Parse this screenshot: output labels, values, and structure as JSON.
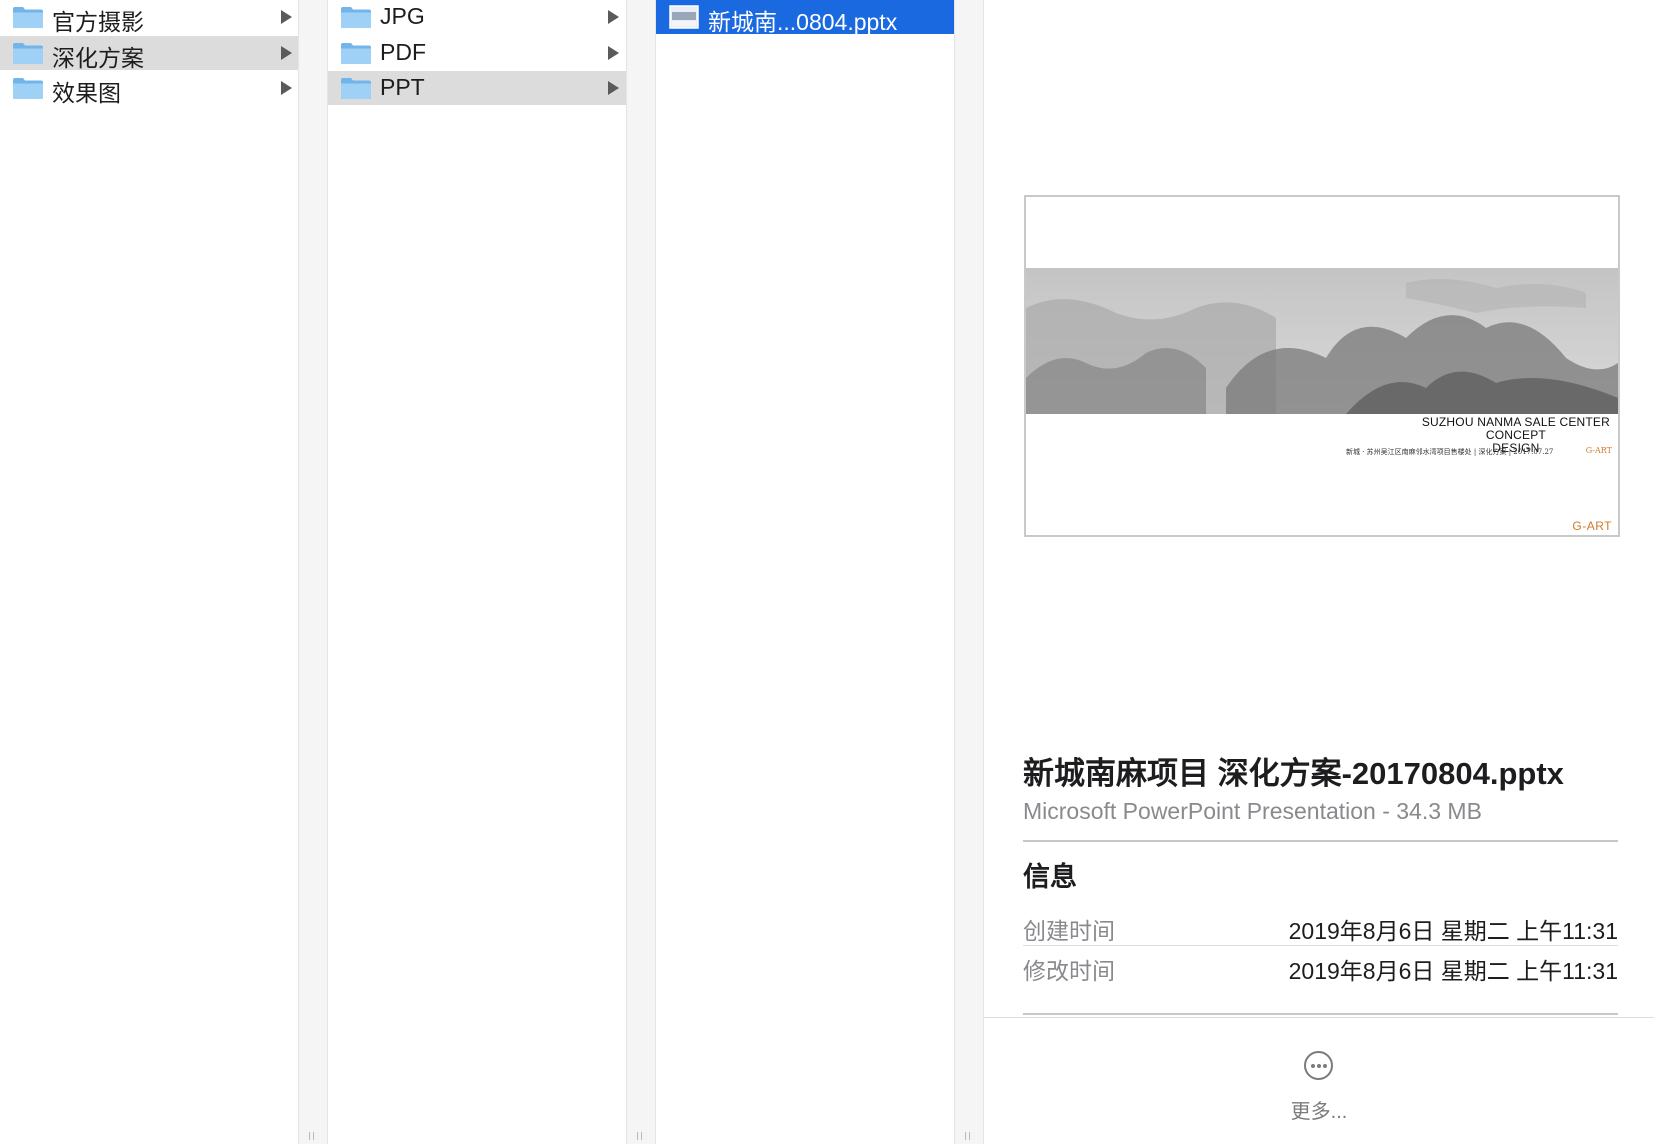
{
  "column1": {
    "items": [
      {
        "label": "官方摄影",
        "selected": false
      },
      {
        "label": "深化方案",
        "selected": true
      },
      {
        "label": "效果图",
        "selected": false
      }
    ]
  },
  "column2": {
    "items": [
      {
        "label": "JPG",
        "selected": false
      },
      {
        "label": "PDF",
        "selected": false
      },
      {
        "label": "PPT",
        "selected": true
      }
    ]
  },
  "column3": {
    "items": [
      {
        "label": "新城南...0804.pptx",
        "selected": true
      }
    ]
  },
  "preview": {
    "thumbnail": {
      "title_line1": "SUZHOU NANMA SALE CENTER",
      "title_line2": "CONCEPT",
      "title_line3": "DESIGN",
      "subtitle": "新城 · 苏州吴江区南麻邻水湾项目售楼处 | 深化方案 | 2017.07.27",
      "logo_small": "G-ART",
      "logo": "G-ART"
    },
    "file_name": "新城南麻项目 深化方案-20170804.pptx",
    "file_kind": "Microsoft PowerPoint Presentation - 34.3 MB",
    "info_heading": "信息",
    "info": [
      {
        "key": "创建时间",
        "value": "2019年8月6日 星期二 上午11:31"
      },
      {
        "key": "修改时间",
        "value": "2019年8月6日 星期二 上午11:31"
      }
    ],
    "more_label": "更多..."
  },
  "colors": {
    "selection_blue": "#1a69e0",
    "selection_gray": "#dcdcdc",
    "folder_blue": "#8cc8f2",
    "logo_orange": "#d07a2a"
  }
}
